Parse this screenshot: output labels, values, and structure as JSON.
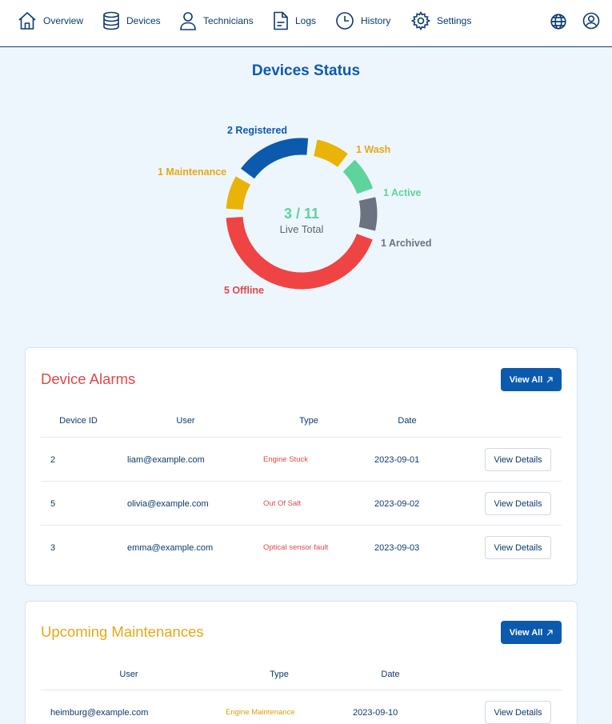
{
  "nav": {
    "overview": "Overview",
    "devices": "Devices",
    "technicians": "Technicians",
    "logs": "Logs",
    "history": "History",
    "settings": "Settings",
    "icons": [
      "home-icon",
      "database-icon",
      "user-icon",
      "document-icon",
      "clock-icon",
      "gear-icon",
      "globe-icon",
      "account-icon"
    ]
  },
  "status": {
    "title": "Devices Status",
    "center_value": "3 / 11",
    "center_label": "Live Total",
    "segments": [
      {
        "label": "2 Registered",
        "count": 2,
        "color": "#0b5aae"
      },
      {
        "label": "1 Wash",
        "count": 1,
        "color": "#eab308"
      },
      {
        "label": "1 Active",
        "count": 1,
        "color": "#5dd49c"
      },
      {
        "label": "1 Archived",
        "count": 1,
        "color": "#6b7280"
      },
      {
        "label": "5 Offline",
        "count": 5,
        "color": "#ef4444"
      },
      {
        "label": "1 Maintenance",
        "count": 1,
        "color": "#eab308"
      }
    ]
  },
  "alarms": {
    "title": "Device Alarms",
    "title_color": "#e04848",
    "view_all": "View All",
    "columns": [
      "Device ID",
      "User",
      "Type",
      "Date"
    ],
    "rows": [
      {
        "device_id": "2",
        "user": "liam@example.com",
        "type": "Engine Stuck",
        "date": "2023-09-01",
        "action": "View Details"
      },
      {
        "device_id": "5",
        "user": "olivia@example.com",
        "type": "Out Of Salt",
        "date": "2023-09-02",
        "action": "View Details"
      },
      {
        "device_id": "3",
        "user": "emma@example.com",
        "type": "Optical sensor fault",
        "date": "2023-09-03",
        "action": "View Details"
      }
    ]
  },
  "maintenances": {
    "title": "Upcoming Maintenances",
    "title_color": "#e6a817",
    "view_all": "View All",
    "columns": [
      "User",
      "Type",
      "Date"
    ],
    "rows": [
      {
        "user": "heimburg@example.com",
        "type": "Engine Maintenance",
        "date": "2023-09-10",
        "action": "View Details"
      }
    ]
  },
  "colors": {
    "accent": "#0b5aae",
    "text": "#0b3a6e",
    "background": "#eef6fd"
  }
}
